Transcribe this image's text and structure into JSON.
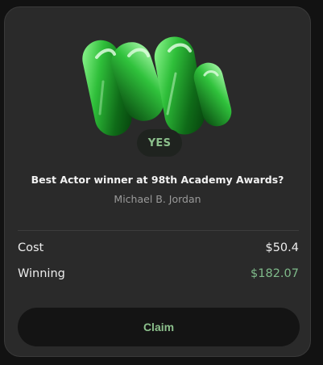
{
  "card": {
    "outcome_badge": "YES",
    "question": "Best Actor winner at 98th Academy Awards?",
    "selection": "Michael B. Jordan",
    "cost_label": "Cost",
    "cost_value": "$50.4",
    "winning_label": "Winning",
    "winning_value": "$182.07",
    "claim_label": "Claim"
  },
  "logo": {
    "icon": "green-glass-w-logo-icon"
  },
  "colors": {
    "card_background": "#2a2a2a",
    "accent_green": "#8cc08c",
    "winning_green": "#7fba8a",
    "button_background": "#141414"
  }
}
